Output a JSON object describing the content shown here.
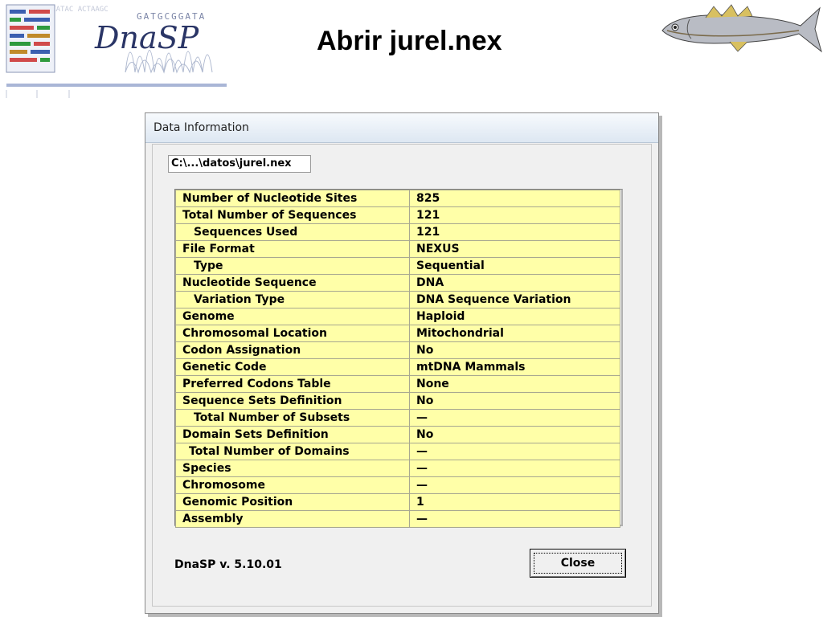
{
  "slide": {
    "title": "Abrir jurel.nex",
    "logo_text": "DnaSP",
    "logo_sequence_text": "GATGCGGATA"
  },
  "dialog": {
    "title": "Data Information",
    "file_path": "C:\\...\\datos\\jurel.nex",
    "version": "DnaSP v. 5.10.01",
    "close_label": "Close"
  },
  "info_rows": [
    {
      "label": "Number of Nucleotide Sites",
      "value": "825"
    },
    {
      "label": "Total Number of Sequences",
      "value": "121"
    },
    {
      "label": "Sequences Used",
      "value": "121"
    },
    {
      "label": "File Format",
      "value": "NEXUS"
    },
    {
      "label": "Type",
      "value": "Sequential"
    },
    {
      "label": "Nucleotide Sequence",
      "value": "DNA"
    },
    {
      "label": "Variation Type",
      "value": "DNA Sequence Variation"
    },
    {
      "label": "Genome",
      "value": "Haploid"
    },
    {
      "label": "Chromosomal Location",
      "value": "Mitochondrial"
    },
    {
      "label": "Codon Assignation",
      "value": "No"
    },
    {
      "label": "Genetic Code",
      "value": "mtDNA Mammals"
    },
    {
      "label": "Preferred Codons Table",
      "value": "None"
    },
    {
      "label": "Sequence Sets Definition",
      "value": "No"
    },
    {
      "label": "Total Number of Subsets",
      "value": "—"
    },
    {
      "label": "Domain Sets Definition",
      "value": "No"
    },
    {
      "label": "Total Number of Domains",
      "value": "—"
    },
    {
      "label": "Species",
      "value": "—"
    },
    {
      "label": "Chromosome",
      "value": "—"
    },
    {
      "label": "Genomic Position",
      "value": "1"
    },
    {
      "label": "Assembly",
      "value": "—"
    }
  ],
  "colors": {
    "grid_background": "#ffffa8",
    "dialog_background": "#f0f0f0"
  }
}
